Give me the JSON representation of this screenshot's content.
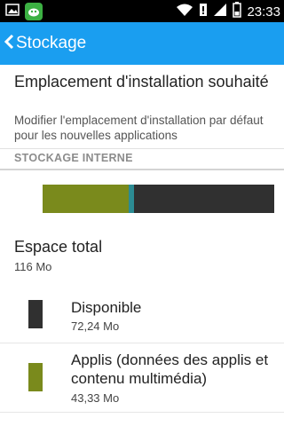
{
  "status_bar": {
    "time": "23:33",
    "icons": [
      "picture-icon",
      "android-app-icon",
      "wifi-icon",
      "sim-icon",
      "signal-icon",
      "battery-icon"
    ]
  },
  "app_bar": {
    "title": "Stockage",
    "background_color": "#1a9ef0"
  },
  "install_location": {
    "title": "Emplacement d'installation souhaité",
    "subtitle": "Modifier l'emplacement d'installation par défaut pour les nouvelles applications"
  },
  "section": {
    "label": "STOCKAGE INTERNE"
  },
  "usage_bar": {
    "segments": [
      {
        "name": "Applis",
        "fraction": 0.373,
        "color": "#7a8a1c"
      },
      {
        "name": "Autre",
        "fraction": 0.023,
        "color": "#2c8b93"
      },
      {
        "name": "Disponible",
        "fraction": 0.604,
        "color": "#303030"
      }
    ]
  },
  "total": {
    "title": "Espace total",
    "value": "116 Mo"
  },
  "items": [
    {
      "title": "Disponible",
      "value": "72,24 Mo",
      "color": "#303030"
    },
    {
      "title": "Applis (données des applis et contenu multimédia)",
      "value": "43,33 Mo",
      "color": "#7a8a1c"
    }
  ]
}
